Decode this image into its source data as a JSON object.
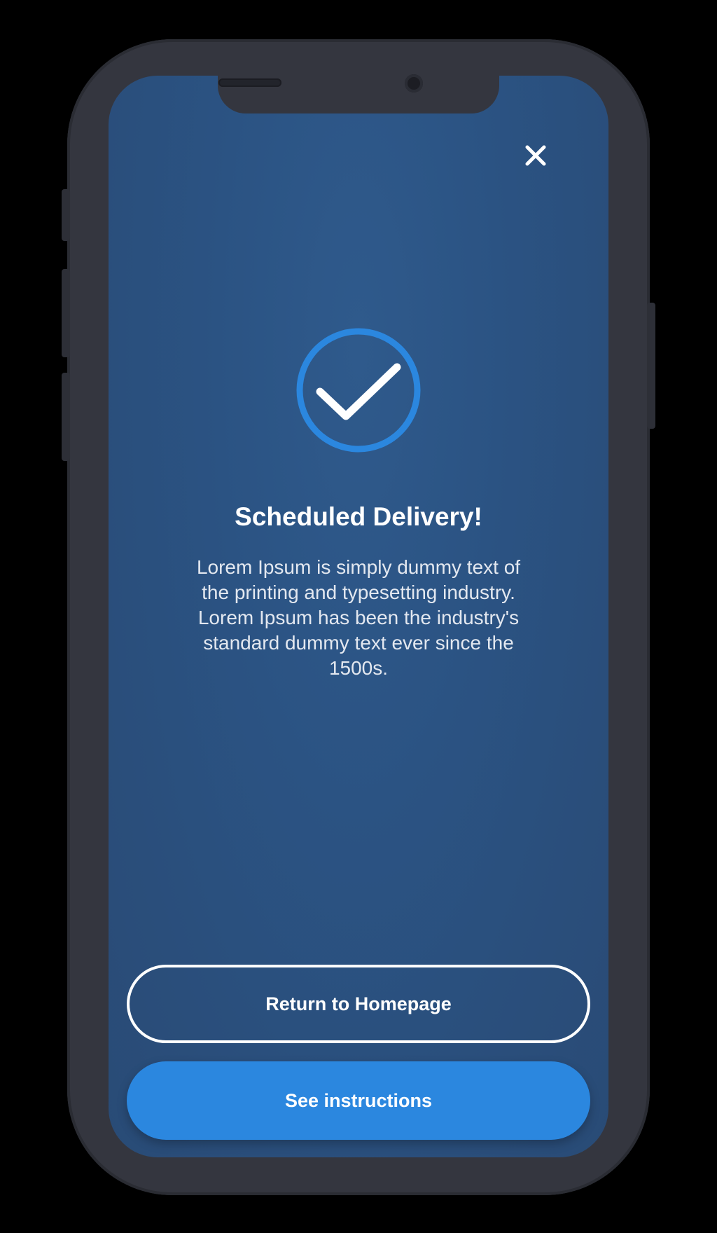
{
  "modal": {
    "title": "Scheduled Delivery!",
    "message": "Lorem Ipsum is simply dummy text of the printing and typesetting industry. Lorem Ipsum has been the industry's standard dummy text ever since the 1500s.",
    "icons": {
      "close": "close-icon",
      "success": "check-circle-icon"
    }
  },
  "actions": {
    "return_label": "Return to Homepage",
    "instructions_label": "See instructions"
  },
  "colors": {
    "background": "#2b5383",
    "accent": "#2b87df",
    "text": "#ffffff",
    "device_frame": "#34363f"
  }
}
